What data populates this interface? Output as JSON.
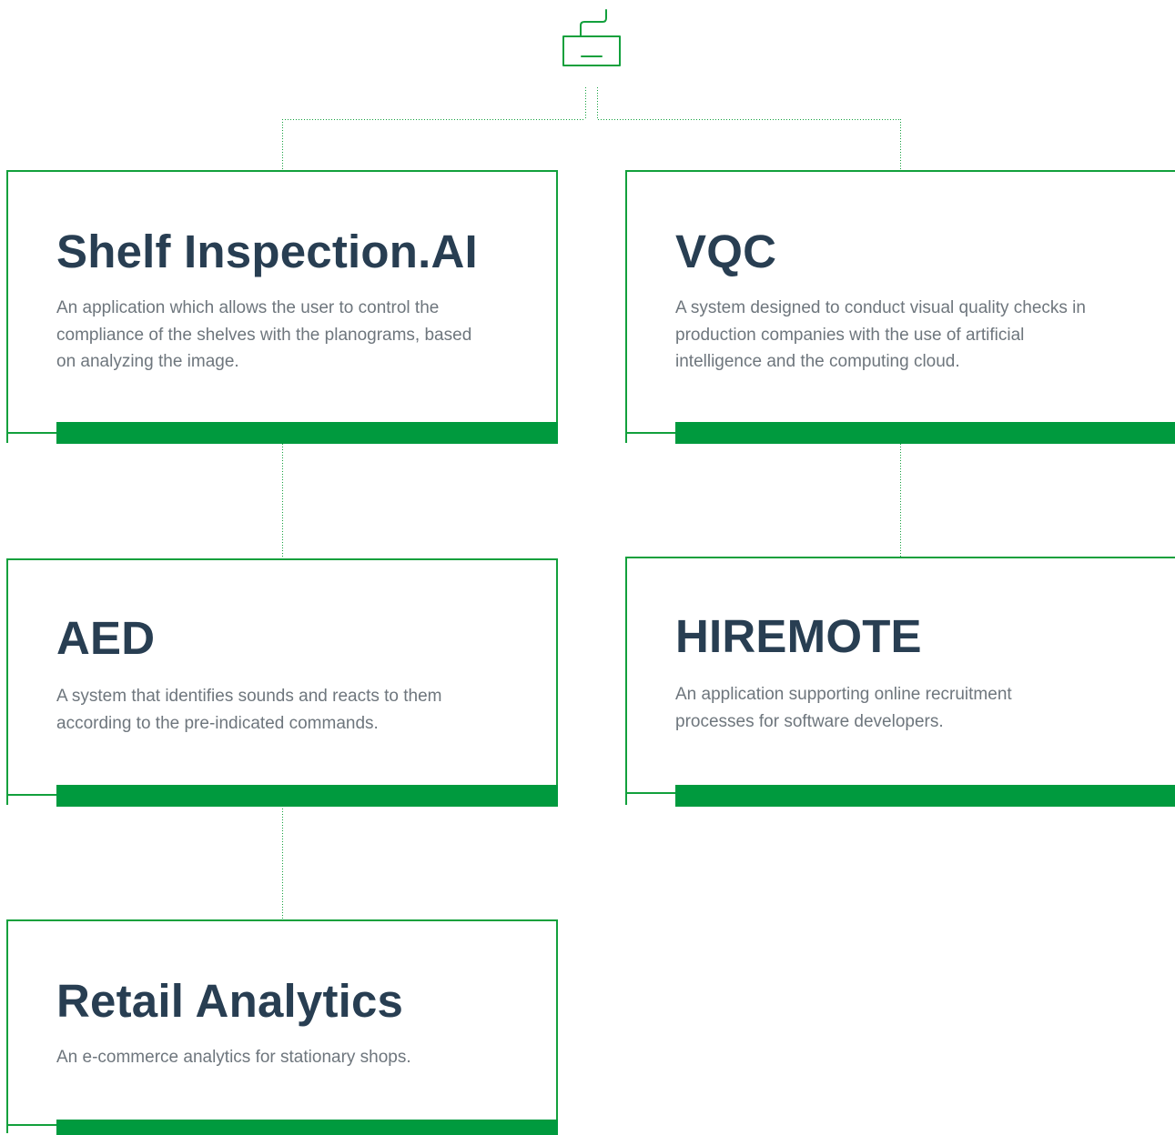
{
  "icon": "keyboard-icon",
  "colors": {
    "accent": "#009a3e",
    "border": "#12a03c",
    "title": "#283e52",
    "text": "#6e767d",
    "connector": "#12a03c"
  },
  "projects": [
    {
      "title": "Shelf Inspection.AI",
      "description": "An application which allows the user to control the compliance of the shelves with the planograms, based on analyzing the image."
    },
    {
      "title": "VQC",
      "description": "A system designed to conduct visual quality checks in production companies with the use of artificial intelligence and the computing cloud."
    },
    {
      "title": "AED",
      "description": "A system that identifies sounds and reacts to them according to the pre-indicated commands."
    },
    {
      "title": "HIREMOTE",
      "description": "An application supporting online recruitment processes for software developers."
    },
    {
      "title": "Retail Analytics",
      "description": "An e-commerce analytics for stationary shops."
    }
  ]
}
